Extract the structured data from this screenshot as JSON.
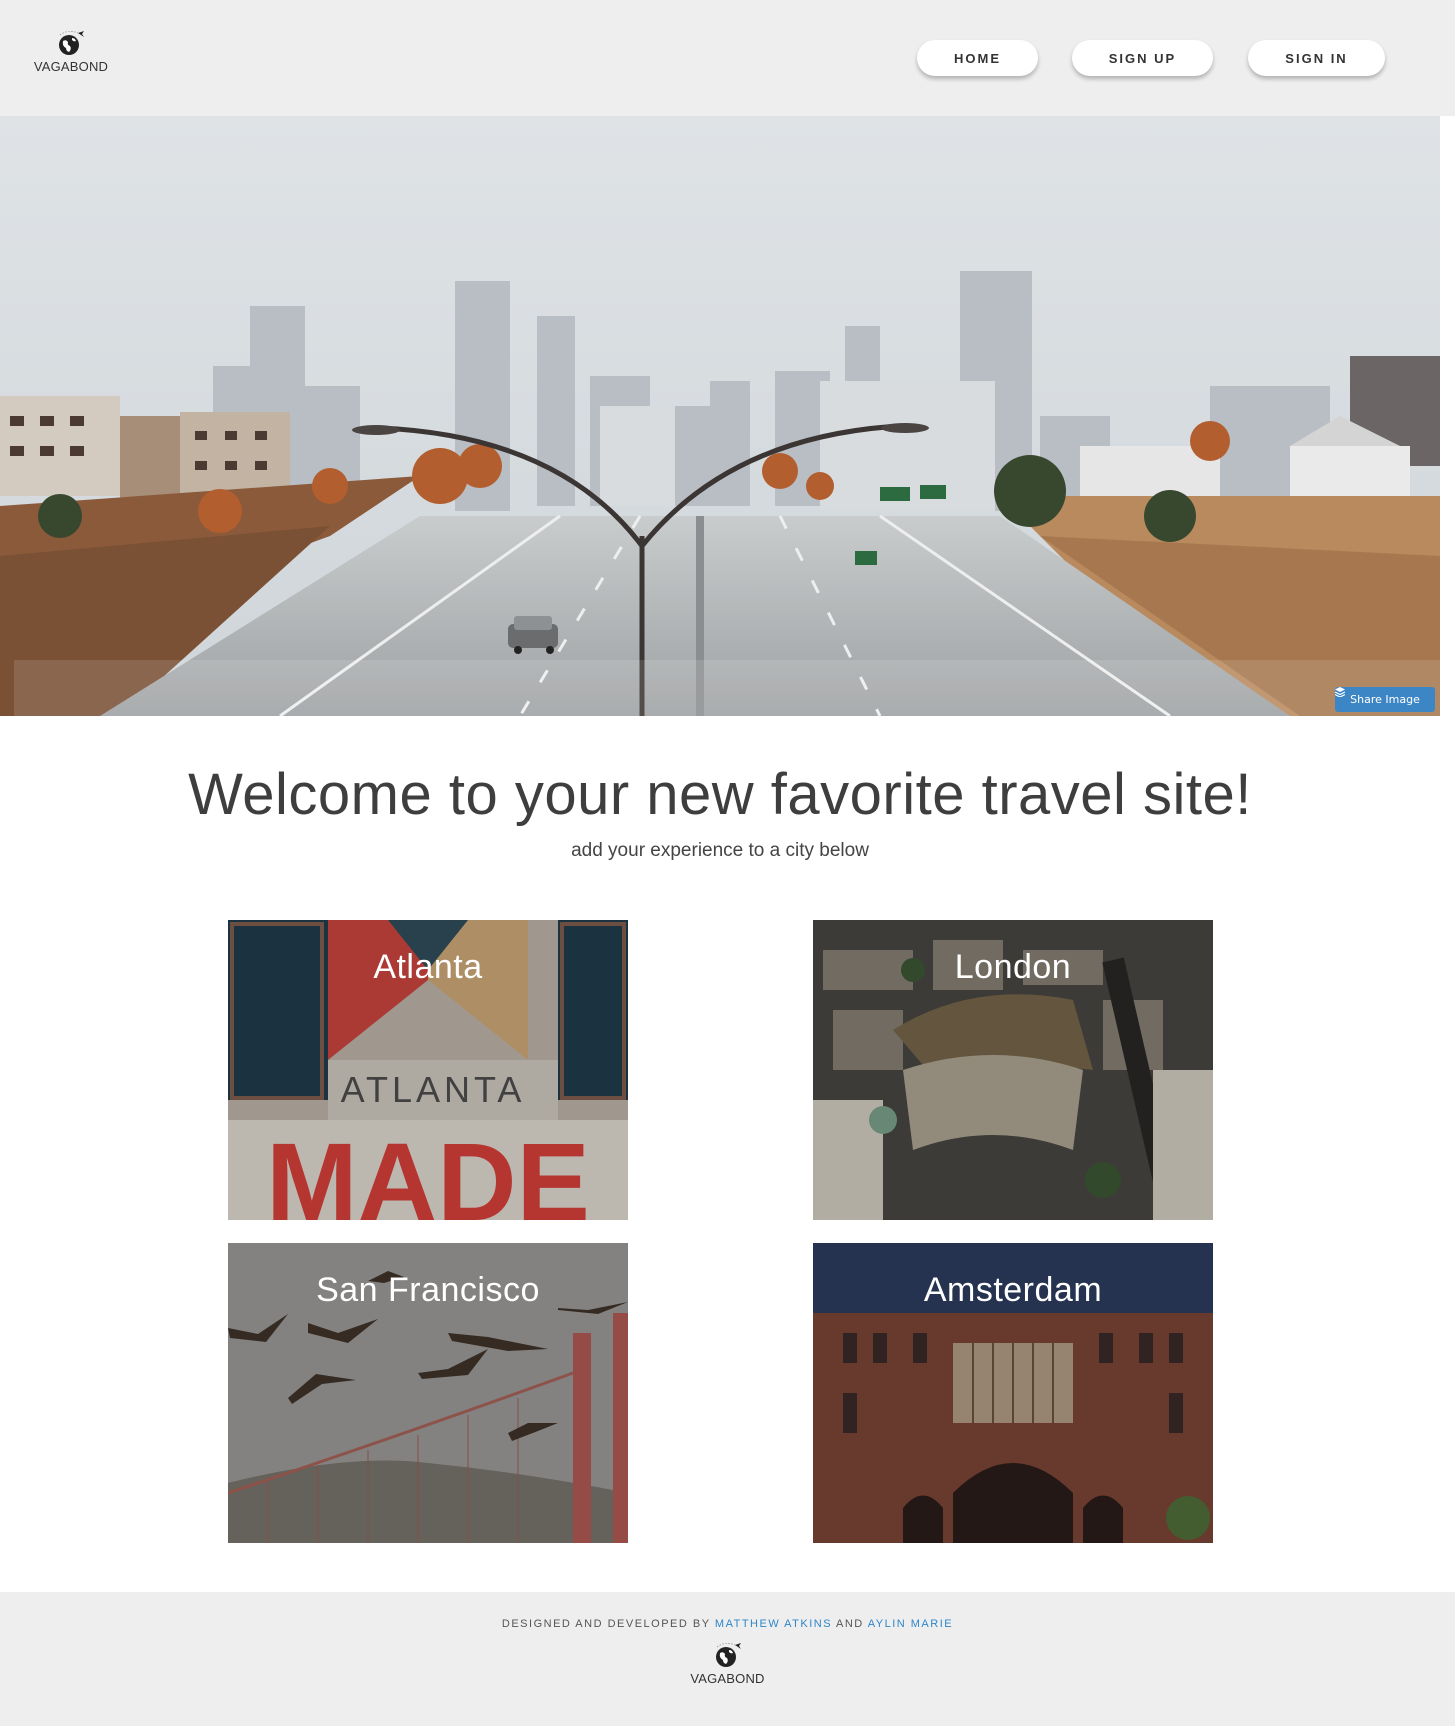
{
  "header": {
    "logo_text": "VAGABOND",
    "logo_icon": "globe-plane-icon",
    "nav": {
      "home": "HOME",
      "sign_up": "SIGN UP",
      "sign_in": "SIGN IN"
    }
  },
  "hero": {
    "share_label": "Share Image",
    "share_icon": "layers-icon"
  },
  "welcome": {
    "title": "Welcome to your new favorite travel site!",
    "subtitle": "add your experience to a city below"
  },
  "cities": {
    "atlanta": {
      "name": "Atlanta",
      "mural_text_1": "ATLANTA",
      "mural_text_2": "MADE"
    },
    "london": {
      "name": "London"
    },
    "san_francisco": {
      "name": "San Francisco"
    },
    "amsterdam": {
      "name": "Amsterdam"
    }
  },
  "footer": {
    "prefix": "DESIGNED AND DEVELOPED BY",
    "author_1": "MATTHEW ATKINS",
    "joiner": "AND",
    "author_2": "AYLIN MARIE",
    "logo_text": "VAGABOND"
  },
  "colors": {
    "link": "#2f86c9",
    "header_bg": "#eeeeee",
    "share_button": "#3d86c6"
  }
}
